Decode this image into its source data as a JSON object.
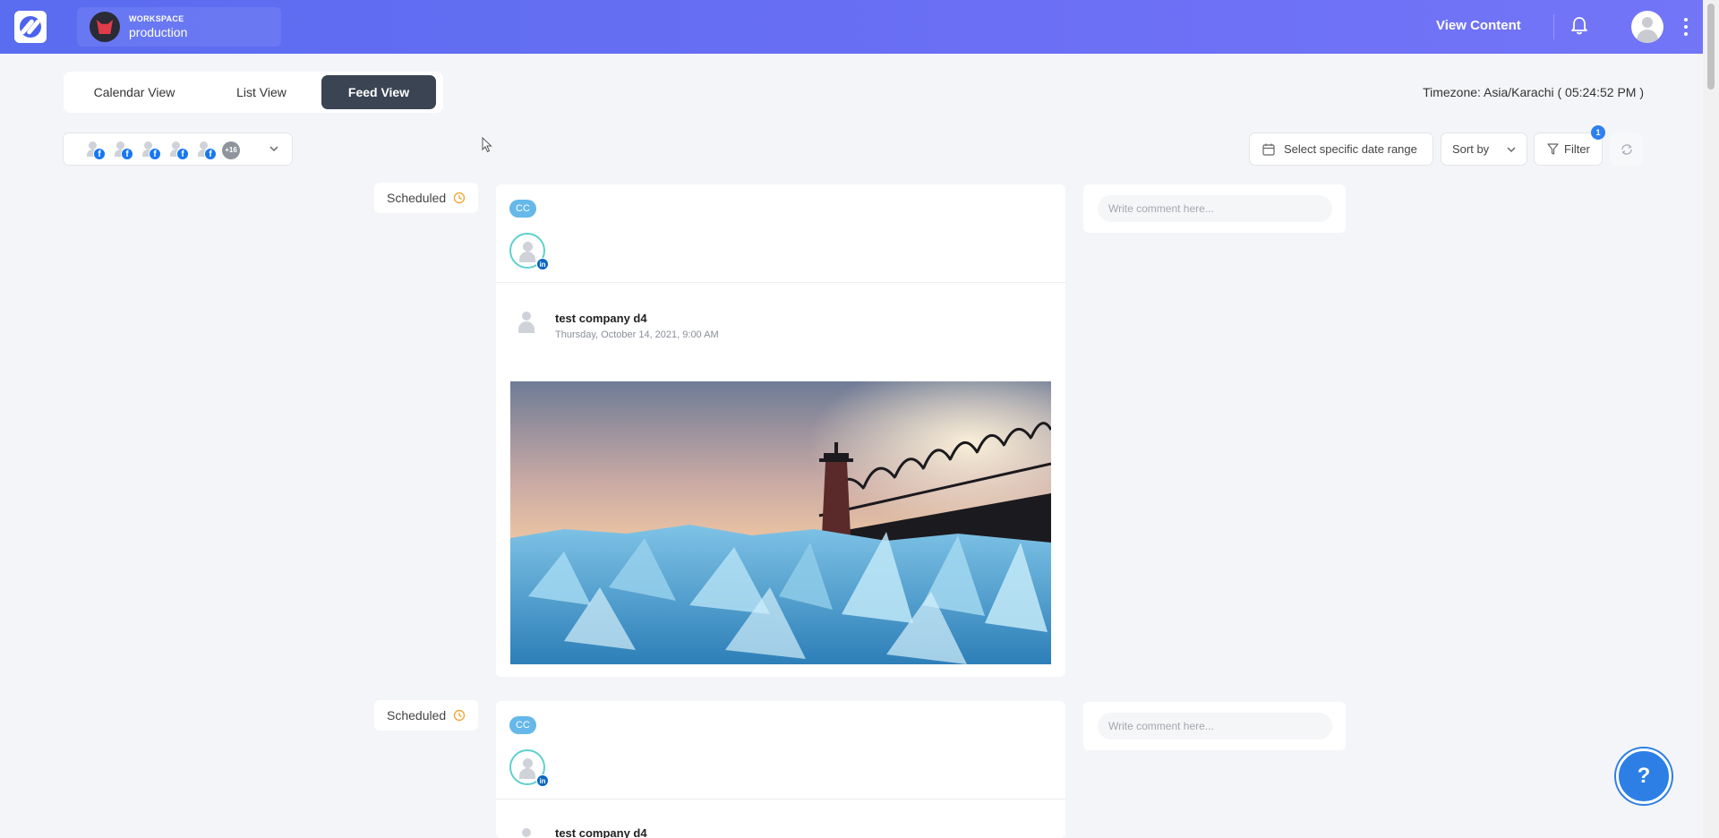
{
  "header": {
    "workspace_label": "WORKSPACE",
    "workspace_name": "production",
    "view_content": "View Content",
    "icons": [
      "brand-logo-icon",
      "bell-icon",
      "user-avatar-icon",
      "kebab-menu-icon"
    ]
  },
  "views": {
    "tabs": [
      {
        "label": "Calendar View",
        "active": false
      },
      {
        "label": "List View",
        "active": false
      },
      {
        "label": "Feed View",
        "active": true
      }
    ],
    "timezone": "Timezone: Asia/Karachi ( 05:24:52 PM )"
  },
  "accounts": {
    "more_count": "+16"
  },
  "filters": {
    "date_range": "Select specific date range",
    "sort_by": "Sort by",
    "filter": "Filter",
    "filter_count": "1"
  },
  "posts": [
    {
      "status": "Scheduled",
      "badge": "CC",
      "author": "test company d4",
      "date": "Thursday, October 14, 2021, 9:00 AM",
      "comment_placeholder": "Write comment here..."
    },
    {
      "status": "Scheduled",
      "badge": "CC",
      "author": "test company d4",
      "comment_placeholder": "Write comment here..."
    }
  ],
  "help": {
    "label": "?"
  },
  "colors": {
    "header_gradient_start": "#5a6cf0",
    "header_gradient_end": "#7375f7",
    "active_tab": "#3b4453",
    "facebook": "#1877f2",
    "linkedin": "#0a66c2",
    "cc_badge": "#65b8e9",
    "help_button": "#2d7fe6"
  }
}
